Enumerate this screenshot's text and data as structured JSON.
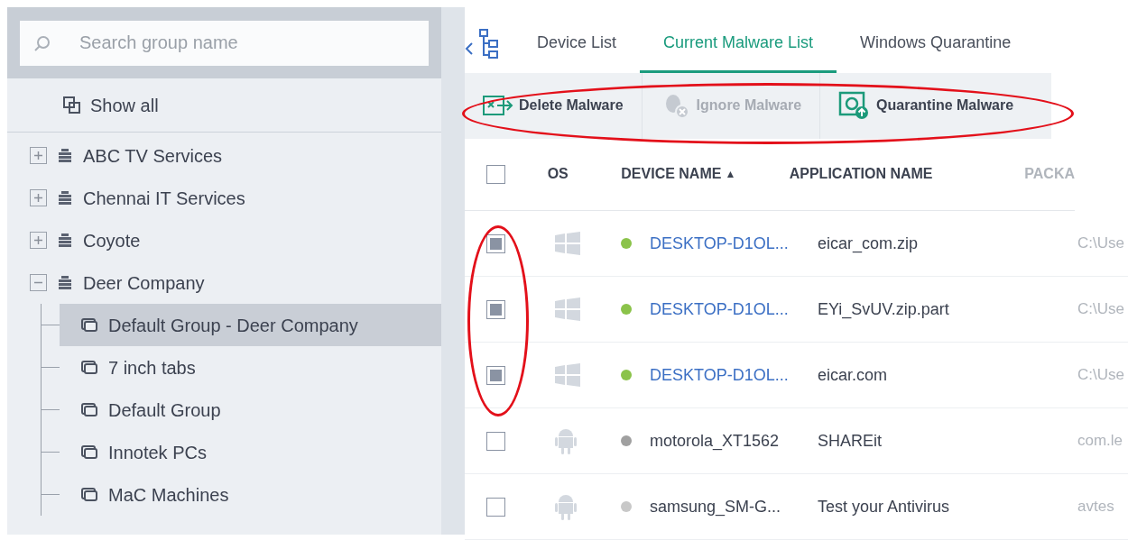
{
  "sidebar": {
    "search": {
      "placeholder": "Search group name"
    },
    "show_all": "Show all",
    "tree": [
      {
        "label": "ABC TV Services",
        "kind": "company",
        "expanded": false,
        "selected": false
      },
      {
        "label": "Chennai IT Services",
        "kind": "company",
        "expanded": false,
        "selected": false
      },
      {
        "label": "Coyote",
        "kind": "company",
        "expanded": false,
        "selected": false
      },
      {
        "label": "Deer Company",
        "kind": "company",
        "expanded": true,
        "selected": false,
        "children": [
          {
            "label": "Default Group - Deer Company",
            "kind": "group",
            "selected": true
          },
          {
            "label": "7 inch tabs",
            "kind": "group",
            "selected": false
          },
          {
            "label": "Default Group",
            "kind": "group",
            "selected": false
          },
          {
            "label": "Innotek PCs",
            "kind": "group",
            "selected": false
          },
          {
            "label": "MaC Machines",
            "kind": "group",
            "selected": false
          }
        ]
      }
    ]
  },
  "tabs": [
    {
      "label": "Device List",
      "selected": false
    },
    {
      "label": "Current Malware List",
      "selected": true
    },
    {
      "label": "Windows Quarantine",
      "selected": false
    }
  ],
  "toolbar": [
    {
      "label": "Delete Malware",
      "kind": "delete",
      "disabled": false
    },
    {
      "label": "Ignore Malware",
      "kind": "ignore",
      "disabled": true
    },
    {
      "label": "Quarantine Malware",
      "kind": "quarantine",
      "disabled": false
    }
  ],
  "table": {
    "header_checked": false,
    "columns": [
      "OS",
      "DEVICE NAME",
      "APPLICATION NAME",
      "PACKA"
    ],
    "sort_icon": "▲",
    "rows": [
      {
        "checked": true,
        "kind": "windows",
        "color": "#8bc34a",
        "link": true,
        "device": "DESKTOP-D1OL...",
        "app": "eicar_com.zip",
        "package": "C:\\Use"
      },
      {
        "checked": true,
        "kind": "windows",
        "color": "#8bc34a",
        "link": true,
        "device": "DESKTOP-D1OL...",
        "app": "EYi_SvUV.zip.part",
        "package": "C:\\Use"
      },
      {
        "checked": true,
        "kind": "windows",
        "color": "#8bc34a",
        "link": true,
        "device": "DESKTOP-D1OL...",
        "app": "eicar.com",
        "package": "C:\\Use"
      },
      {
        "checked": false,
        "kind": "android",
        "color": "#a0a0a0",
        "link": false,
        "device": "motorola_XT1562",
        "app": "SHAREit",
        "package": "com.le"
      },
      {
        "checked": false,
        "kind": "android",
        "color": "#c8c8c8",
        "link": false,
        "device": "samsung_SM-G...",
        "app": "Test your Antivirus",
        "package": "avtes"
      }
    ]
  }
}
